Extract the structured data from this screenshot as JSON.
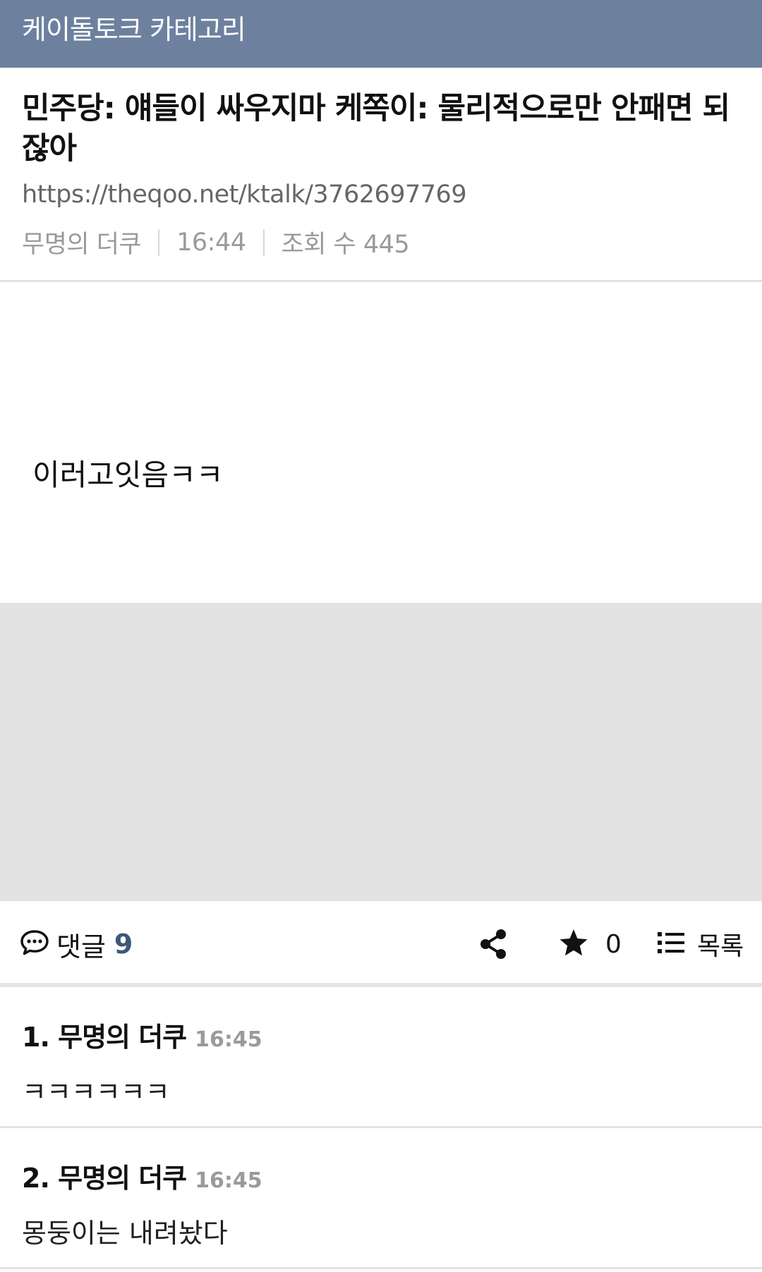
{
  "category_bar": {
    "title": "케이돌토크 카테고리"
  },
  "post": {
    "title": "민주당: 얘들이 싸우지마 케쪽이: 물리적으로만 안패면 되잖아",
    "url": "https://theqoo.net/ktalk/3762697769",
    "author": "무명의 더쿠",
    "time": "16:44",
    "views": "조회 수 445",
    "body": "이러고잇음ㅋㅋ"
  },
  "actions": {
    "comments_label": "댓글",
    "comments_count": "9",
    "star_count": "0",
    "list_label": "목록"
  },
  "comments": [
    {
      "head": "1. 무명의 더쿠",
      "time": "16:45",
      "text": "ㅋㅋㅋㅋㅋㅋ"
    },
    {
      "head": "2. 무명의 더쿠",
      "time": "16:45",
      "text": "몽둥이는 내려놨다"
    }
  ],
  "colors": {
    "category_bar": "#6d819f",
    "comment_count": "#3d5878",
    "ad_placeholder": "#e2e2e2"
  }
}
